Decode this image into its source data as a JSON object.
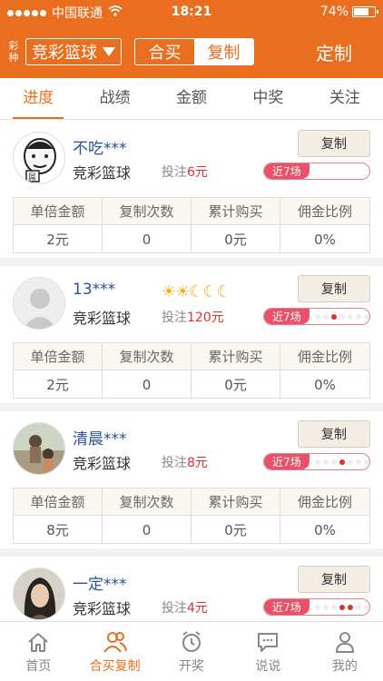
{
  "status": {
    "carrier": "中国联通",
    "time": "18:21",
    "battery": "74%",
    "battery_level": 0.74
  },
  "header": {
    "lottery_label": "彩种",
    "lottery_selected": "竞彩篮球",
    "segment": [
      "合买",
      "复制"
    ],
    "segment_active": 1,
    "customize": "定制"
  },
  "tabs": [
    "进度",
    "战绩",
    "金额",
    "中奖",
    "关注"
  ],
  "columns": [
    "单倍金额",
    "复制次数",
    "累计购买",
    "佣金比例"
  ],
  "copy_label": "复制",
  "recent_label": "近7场",
  "cards": [
    {
      "name": "不吃***",
      "lottery": "竞彩篮球",
      "bet_label": "投注",
      "bet_amount": "6元",
      "stars": "",
      "values": [
        "2元",
        "0",
        "0元",
        "0%"
      ]
    },
    {
      "name": "13***",
      "lottery": "竞彩篮球",
      "bet_label": "投注",
      "bet_amount": "120元",
      "stars": "☀☀☾☾☾",
      "values": [
        "2元",
        "0",
        "0元",
        "0%"
      ]
    },
    {
      "name": "清晨***",
      "lottery": "竞彩篮球",
      "bet_label": "投注",
      "bet_amount": "8元",
      "stars": "",
      "values": [
        "8元",
        "0",
        "0元",
        "0%"
      ]
    },
    {
      "name": "一定***",
      "lottery": "竞彩篮球",
      "bet_label": "投注",
      "bet_amount": "4元",
      "stars": "",
      "values": []
    }
  ],
  "bottom_nav": [
    "首页",
    "合买复制",
    "开奖",
    "说说",
    "我的"
  ],
  "colors": {
    "accent": "#ea6e1f",
    "link": "#2a4f9c",
    "danger": "#e0322b"
  }
}
